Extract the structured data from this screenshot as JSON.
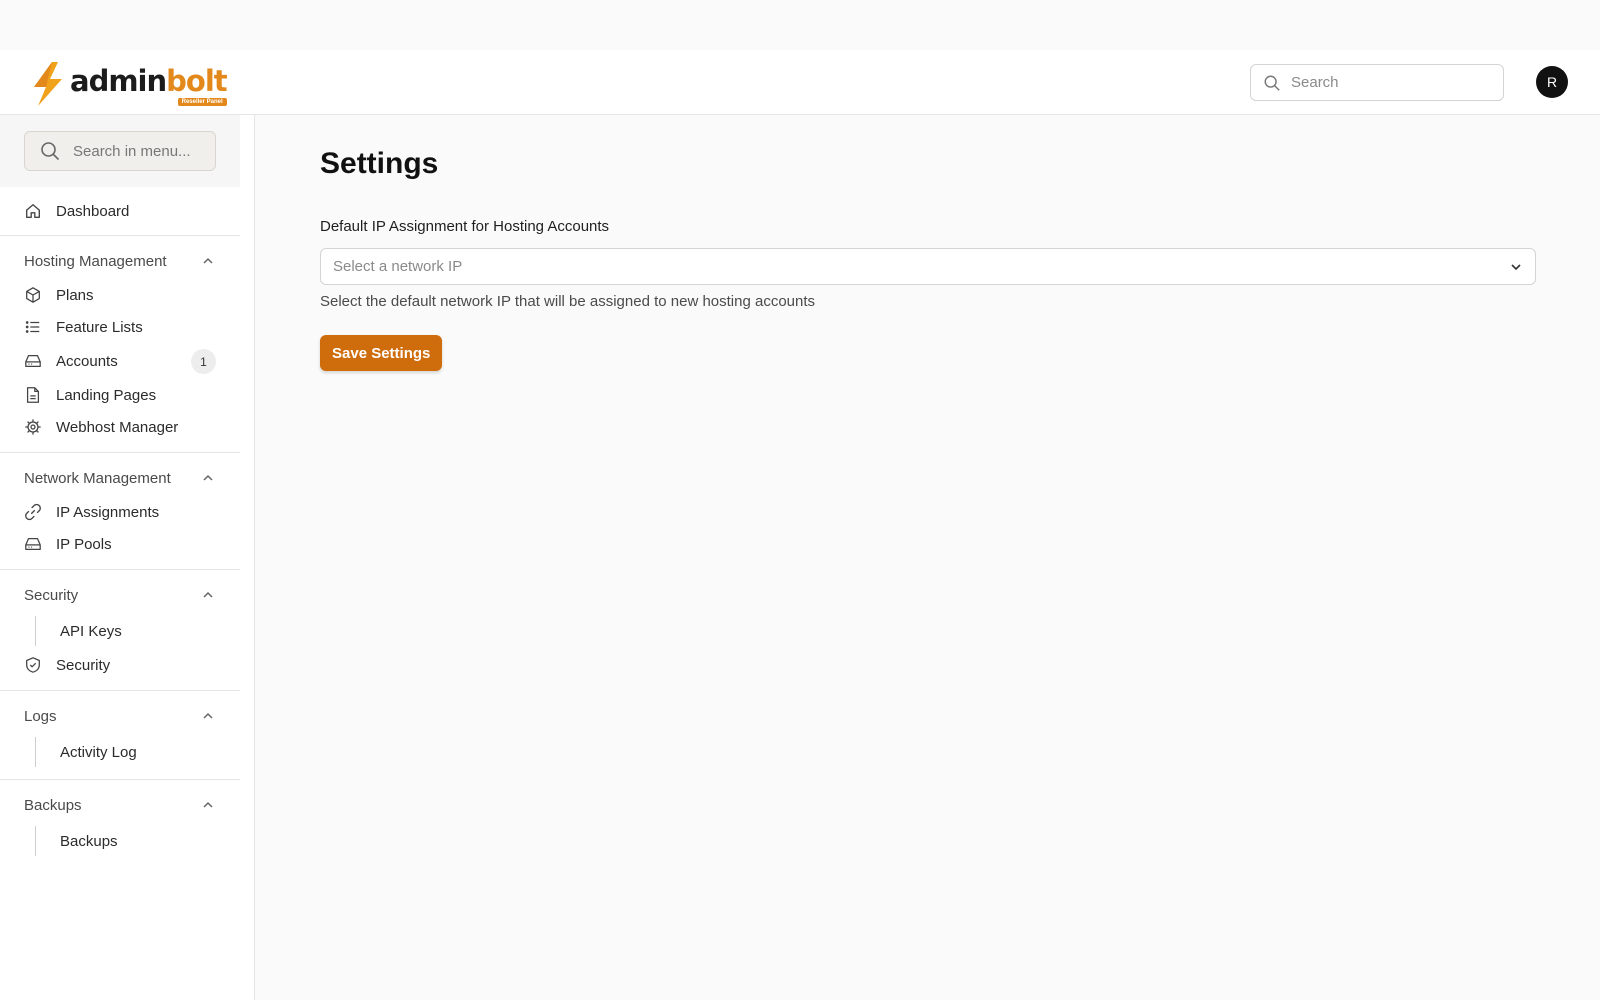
{
  "brand": {
    "name_part1": "admin",
    "name_part2": "bolt",
    "badge": "Reseller Panel",
    "accent_color": "#e3891c"
  },
  "header": {
    "search_placeholder": "Search",
    "avatar_initial": "R"
  },
  "sidebar": {
    "search_placeholder": "Search in menu...",
    "dashboard": "Dashboard",
    "sections": {
      "hosting": {
        "title": "Hosting Management",
        "items": {
          "plans": "Plans",
          "feature_lists": "Feature Lists",
          "accounts": "Accounts",
          "accounts_badge": "1",
          "landing_pages": "Landing Pages",
          "webhost_manager": "Webhost Manager"
        }
      },
      "network": {
        "title": "Network Management",
        "items": {
          "ip_assignments": "IP Assignments",
          "ip_pools": "IP Pools"
        }
      },
      "security": {
        "title": "Security",
        "items": {
          "api_keys": "API Keys",
          "security": "Security"
        }
      },
      "logs": {
        "title": "Logs",
        "items": {
          "activity_log": "Activity Log"
        }
      },
      "backups": {
        "title": "Backups",
        "items": {
          "backups": "Backups"
        }
      }
    }
  },
  "main": {
    "title": "Settings",
    "field_label": "Default IP Assignment for Hosting Accounts",
    "select_placeholder": "Select a network IP",
    "help_text": "Select the default network IP that will be assigned to new hosting accounts",
    "save_button": "Save Settings",
    "button_color": "#cf6c0c"
  }
}
